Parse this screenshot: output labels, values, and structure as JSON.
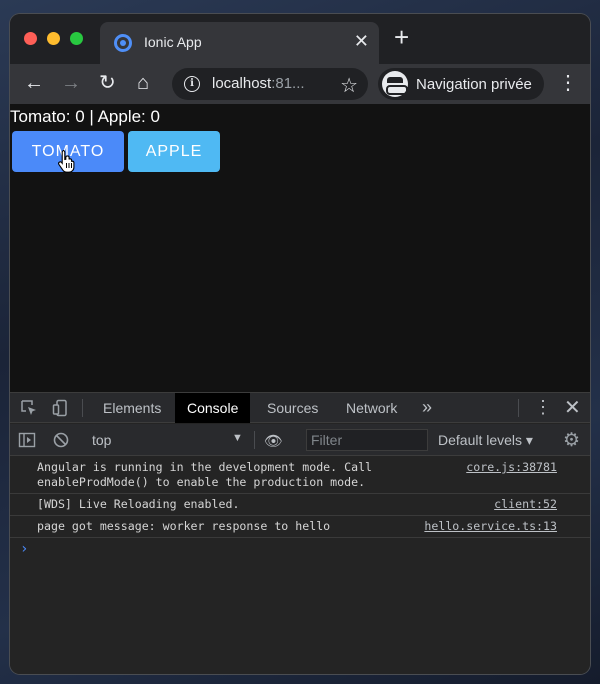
{
  "tab": {
    "title": "Ionic App"
  },
  "toolbar": {
    "url_host": "localhost",
    "url_rest": ":81...",
    "incognito_label": "Navigation privée"
  },
  "page": {
    "counter_text": "Tomato: 0 | Apple: 0",
    "buttons": {
      "tomato": "TOMATO",
      "apple": "APPLE"
    }
  },
  "devtools": {
    "tabs": [
      "Elements",
      "Console",
      "Sources",
      "Network"
    ],
    "active_tab": "Console",
    "context": "top",
    "filter_placeholder": "Filter",
    "levels": "Default levels",
    "logs": [
      {
        "message": "Angular is running in the development mode. Call enableProdMode() to enable the production mode.",
        "source": "core.js:38781"
      },
      {
        "message": "[WDS] Live Reloading enabled.",
        "source": "client:52"
      },
      {
        "message": "page got message: worker response to hello",
        "source": "hello.service.ts:13"
      }
    ]
  },
  "colors": {
    "tomato_button": "#4b8af9",
    "apple_button": "#4fb9f3",
    "page_bg": "#121212"
  }
}
